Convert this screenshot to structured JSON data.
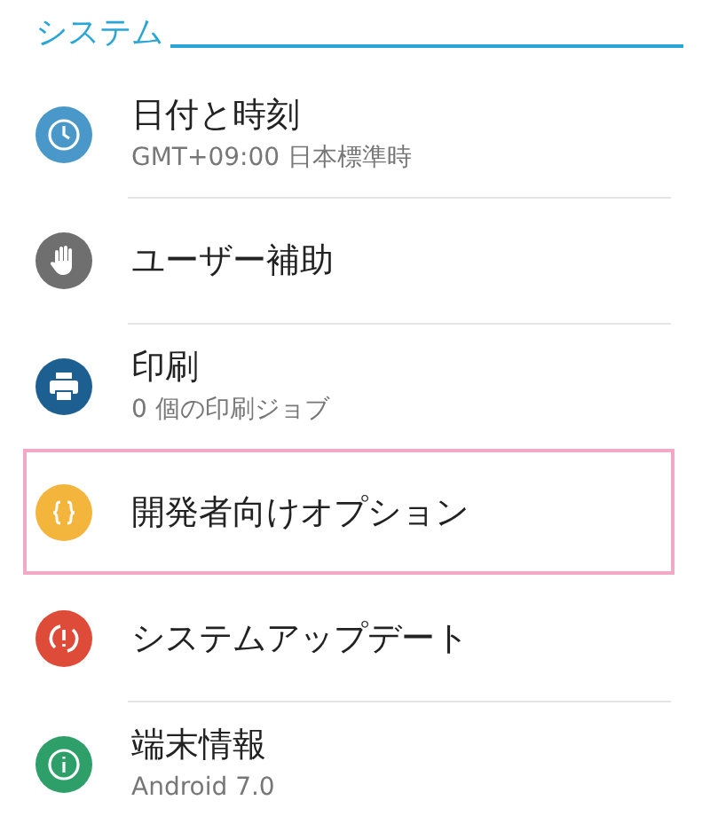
{
  "section": {
    "title": "システム"
  },
  "items": [
    {
      "title": "日付と時刻",
      "subtitle": "GMT+09:00 日本標準時",
      "kind": "clock",
      "color": "#4a98c9",
      "highlighted": false
    },
    {
      "title": "ユーザー補助",
      "kind": "hand",
      "color": "#6f6f6f",
      "highlighted": false
    },
    {
      "title": "印刷",
      "subtitle": "0 個の印刷ジョブ",
      "kind": "printer",
      "color": "#1e5f92",
      "highlighted": false
    },
    {
      "title": "開発者向けオプション",
      "kind": "braces",
      "color": "#f3b53c",
      "highlighted": true
    },
    {
      "title": "システムアップデート",
      "kind": "update",
      "color": "#de4b39",
      "highlighted": false
    },
    {
      "title": "端末情報",
      "subtitle": "Android 7.0",
      "kind": "info",
      "color": "#2f9f6a",
      "highlighted": false
    }
  ]
}
